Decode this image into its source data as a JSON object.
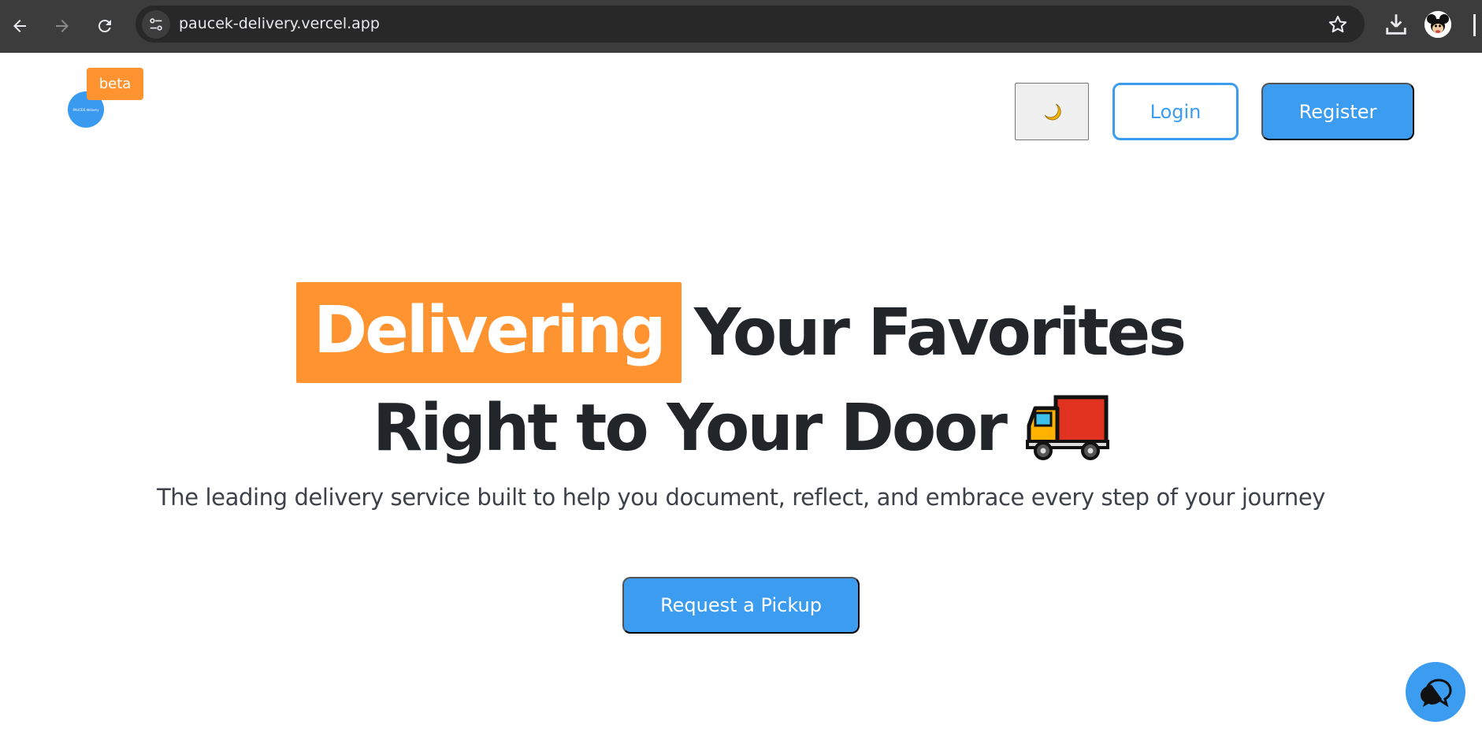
{
  "browser": {
    "url": "paucek-delivery.vercel.app",
    "icons": [
      "back-icon",
      "forward-icon",
      "reload-icon",
      "site-info-icon",
      "star-icon",
      "download-icon",
      "profile-avatar"
    ]
  },
  "header": {
    "logo_mini_text": "PAUCEK\ndelivery",
    "beta_label": "beta",
    "theme_toggle_icon": "moon-icon",
    "login_label": "Login",
    "register_label": "Register"
  },
  "hero": {
    "highlight_word": "Delivering",
    "line1_rest": "Your Favorites",
    "line2": "Right to Your Door",
    "line2_icon": "delivery-truck-icon",
    "subtitle": "The leading delivery service built to help you document, reflect, and embrace every step of your journey",
    "cta_label": "Request a Pickup"
  },
  "chat": {
    "icon": "chat-icon"
  },
  "colors": {
    "primary_blue": "#3b9cf0",
    "accent_orange": "#ff9330",
    "heading_dark": "#22252a",
    "chrome_dark": "#3c3c3c"
  }
}
